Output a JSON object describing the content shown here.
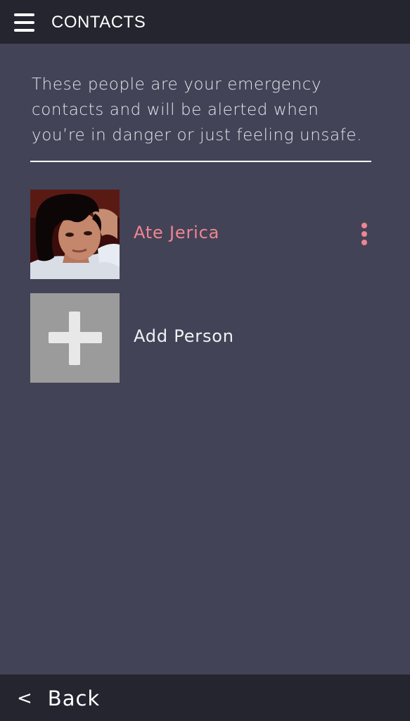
{
  "header": {
    "title": "CONTACTS",
    "menu_icon": "hamburger-menu-icon"
  },
  "intro": {
    "text": "These people are your emergency contacts and will be alerted when you’re in danger or just feeling unsafe."
  },
  "contacts": [
    {
      "name": "Ate Jerica",
      "avatar": "profile-photo",
      "more_icon": "more-vertical-icon"
    }
  ],
  "add_person": {
    "label": "Add Person",
    "icon": "plus-icon"
  },
  "footer": {
    "back_chevron": "<",
    "back_label": "Back"
  },
  "colors": {
    "background": "#434357",
    "bar": "#25252f",
    "accent_pink": "#f08590",
    "add_tile": "#9b9b9b"
  }
}
